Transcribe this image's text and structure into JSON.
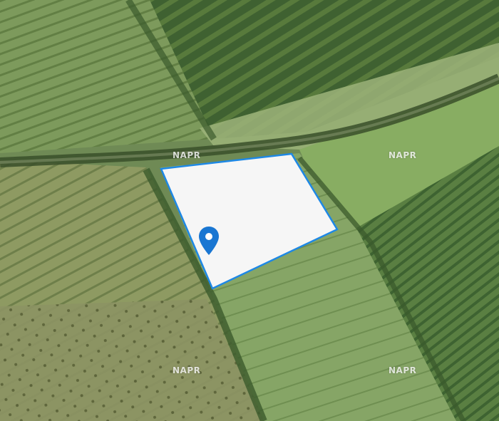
{
  "map": {
    "watermarks": [
      "NAPR",
      "NAPR",
      "NAPR",
      "NAPR"
    ],
    "parcel": {
      "fill": "#f6f6f6",
      "stroke": "#1e88e5"
    },
    "marker": {
      "icon": "map-pin-icon",
      "color": "#1976d2"
    }
  }
}
